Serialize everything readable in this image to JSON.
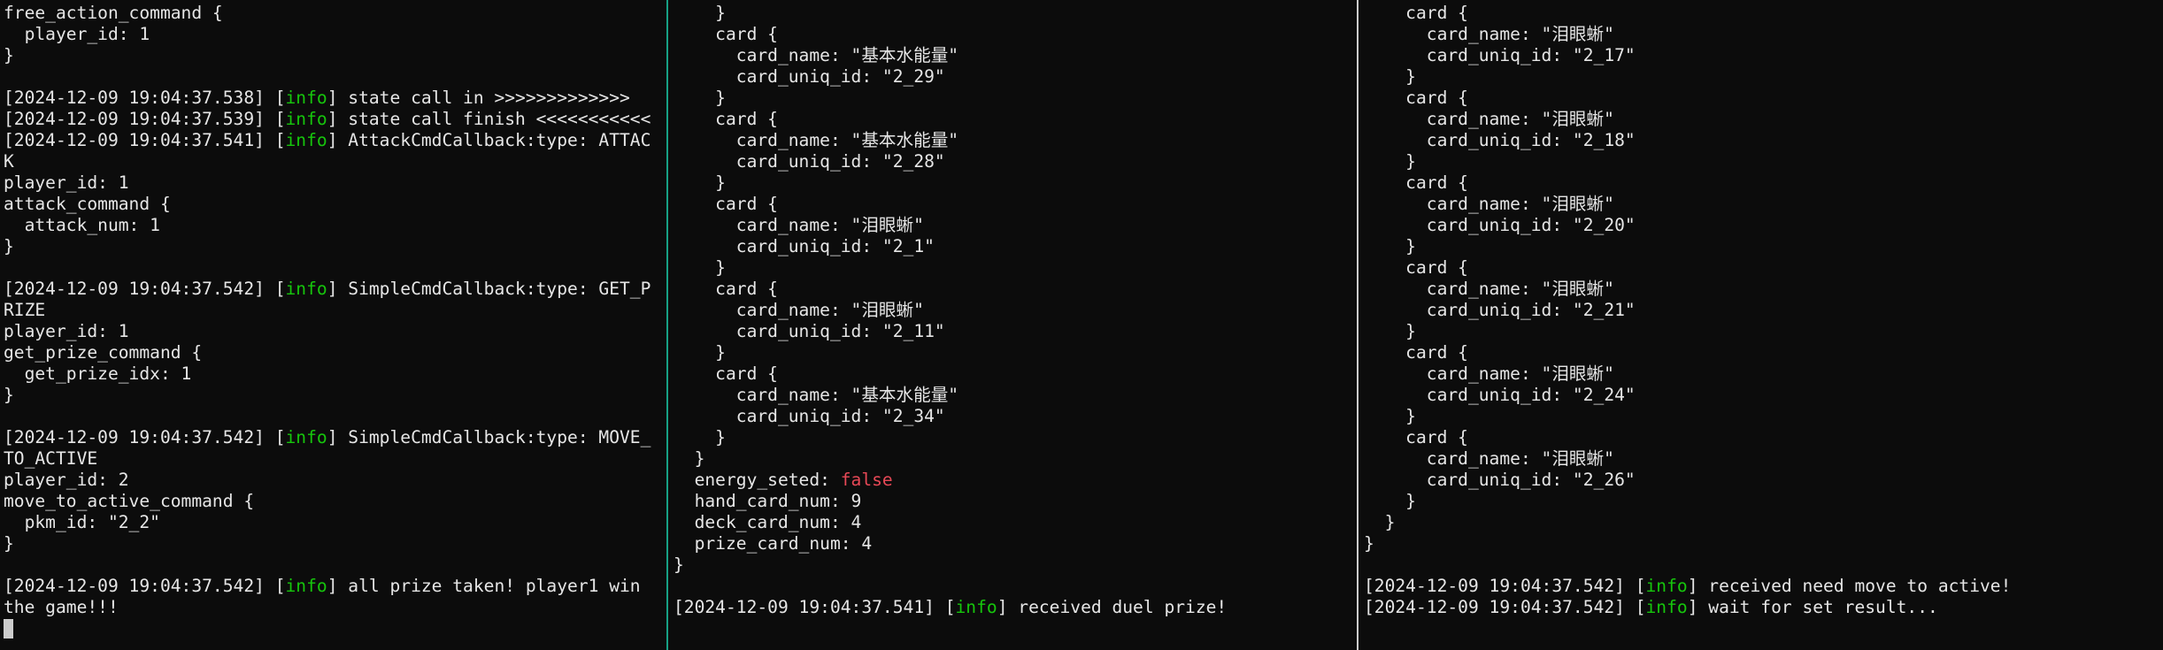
{
  "colors": {
    "background": "#0c0c0c",
    "text": "#e6e6e6",
    "info": "#16c60c",
    "false_literal": "#e74856",
    "divider_1": "#16a085",
    "divider_2": "#cccccc",
    "cursor": "#cccccc"
  },
  "panes": [
    {
      "lines": [
        [
          {
            "t": "free_action_command {"
          }
        ],
        [
          {
            "t": "  player_id: 1"
          }
        ],
        [
          {
            "t": "}"
          }
        ],
        [
          {
            "t": ""
          }
        ],
        [
          {
            "t": "[2024-12-09 19:04:37.538] ["
          },
          {
            "t": "info",
            "c": "info"
          },
          {
            "t": "] state call in >>>>>>>>>>>>>"
          }
        ],
        [
          {
            "t": "[2024-12-09 19:04:37.539] ["
          },
          {
            "t": "info",
            "c": "info"
          },
          {
            "t": "] state call finish <<<<<<<<<<<"
          }
        ],
        [
          {
            "t": "[2024-12-09 19:04:37.541] ["
          },
          {
            "t": "info",
            "c": "info"
          },
          {
            "t": "] AttackCmdCallback:type: ATTAC"
          }
        ],
        [
          {
            "t": "K"
          }
        ],
        [
          {
            "t": "player_id: 1"
          }
        ],
        [
          {
            "t": "attack_command {"
          }
        ],
        [
          {
            "t": "  attack_num: 1"
          }
        ],
        [
          {
            "t": "}"
          }
        ],
        [
          {
            "t": ""
          }
        ],
        [
          {
            "t": "[2024-12-09 19:04:37.542] ["
          },
          {
            "t": "info",
            "c": "info"
          },
          {
            "t": "] SimpleCmdCallback:type: GET_P"
          }
        ],
        [
          {
            "t": "RIZE"
          }
        ],
        [
          {
            "t": "player_id: 1"
          }
        ],
        [
          {
            "t": "get_prize_command {"
          }
        ],
        [
          {
            "t": "  get_prize_idx: 1"
          }
        ],
        [
          {
            "t": "}"
          }
        ],
        [
          {
            "t": ""
          }
        ],
        [
          {
            "t": "[2024-12-09 19:04:37.542] ["
          },
          {
            "t": "info",
            "c": "info"
          },
          {
            "t": "] SimpleCmdCallback:type: MOVE_"
          }
        ],
        [
          {
            "t": "TO_ACTIVE"
          }
        ],
        [
          {
            "t": "player_id: 2"
          }
        ],
        [
          {
            "t": "move_to_active_command {"
          }
        ],
        [
          {
            "t": "  pkm_id: \"2_2\""
          }
        ],
        [
          {
            "t": "}"
          }
        ],
        [
          {
            "t": ""
          }
        ],
        [
          {
            "t": "[2024-12-09 19:04:37.542] ["
          },
          {
            "t": "info",
            "c": "info"
          },
          {
            "t": "] all prize taken! player1 win"
          }
        ],
        [
          {
            "t": "the game!!!"
          }
        ]
      ]
    },
    {
      "lines": [
        [
          {
            "t": "    }"
          }
        ],
        [
          {
            "t": "    card {"
          }
        ],
        [
          {
            "t": "      card_name: \"基本水能量\""
          }
        ],
        [
          {
            "t": "      card_uniq_id: \"2_29\""
          }
        ],
        [
          {
            "t": "    }"
          }
        ],
        [
          {
            "t": "    card {"
          }
        ],
        [
          {
            "t": "      card_name: \"基本水能量\""
          }
        ],
        [
          {
            "t": "      card_uniq_id: \"2_28\""
          }
        ],
        [
          {
            "t": "    }"
          }
        ],
        [
          {
            "t": "    card {"
          }
        ],
        [
          {
            "t": "      card_name: \"泪眼蜥\""
          }
        ],
        [
          {
            "t": "      card_uniq_id: \"2_1\""
          }
        ],
        [
          {
            "t": "    }"
          }
        ],
        [
          {
            "t": "    card {"
          }
        ],
        [
          {
            "t": "      card_name: \"泪眼蜥\""
          }
        ],
        [
          {
            "t": "      card_uniq_id: \"2_11\""
          }
        ],
        [
          {
            "t": "    }"
          }
        ],
        [
          {
            "t": "    card {"
          }
        ],
        [
          {
            "t": "      card_name: \"基本水能量\""
          }
        ],
        [
          {
            "t": "      card_uniq_id: \"2_34\""
          }
        ],
        [
          {
            "t": "    }"
          }
        ],
        [
          {
            "t": "  }"
          }
        ],
        [
          {
            "t": "  energy_seted: "
          },
          {
            "t": "false",
            "c": "bool"
          }
        ],
        [
          {
            "t": "  hand_card_num: 9"
          }
        ],
        [
          {
            "t": "  deck_card_num: 4"
          }
        ],
        [
          {
            "t": "  prize_card_num: 4"
          }
        ],
        [
          {
            "t": "}"
          }
        ],
        [
          {
            "t": ""
          }
        ],
        [
          {
            "t": "[2024-12-09 19:04:37.541] ["
          },
          {
            "t": "info",
            "c": "info"
          },
          {
            "t": "] received duel prize!"
          }
        ]
      ]
    },
    {
      "lines": [
        [
          {
            "t": "    card {"
          }
        ],
        [
          {
            "t": "      card_name: \"泪眼蜥\""
          }
        ],
        [
          {
            "t": "      card_uniq_id: \"2_17\""
          }
        ],
        [
          {
            "t": "    }"
          }
        ],
        [
          {
            "t": "    card {"
          }
        ],
        [
          {
            "t": "      card_name: \"泪眼蜥\""
          }
        ],
        [
          {
            "t": "      card_uniq_id: \"2_18\""
          }
        ],
        [
          {
            "t": "    }"
          }
        ],
        [
          {
            "t": "    card {"
          }
        ],
        [
          {
            "t": "      card_name: \"泪眼蜥\""
          }
        ],
        [
          {
            "t": "      card_uniq_id: \"2_20\""
          }
        ],
        [
          {
            "t": "    }"
          }
        ],
        [
          {
            "t": "    card {"
          }
        ],
        [
          {
            "t": "      card_name: \"泪眼蜥\""
          }
        ],
        [
          {
            "t": "      card_uniq_id: \"2_21\""
          }
        ],
        [
          {
            "t": "    }"
          }
        ],
        [
          {
            "t": "    card {"
          }
        ],
        [
          {
            "t": "      card_name: \"泪眼蜥\""
          }
        ],
        [
          {
            "t": "      card_uniq_id: \"2_24\""
          }
        ],
        [
          {
            "t": "    }"
          }
        ],
        [
          {
            "t": "    card {"
          }
        ],
        [
          {
            "t": "      card_name: \"泪眼蜥\""
          }
        ],
        [
          {
            "t": "      card_uniq_id: \"2_26\""
          }
        ],
        [
          {
            "t": "    }"
          }
        ],
        [
          {
            "t": "  }"
          }
        ],
        [
          {
            "t": "}"
          }
        ],
        [
          {
            "t": ""
          }
        ],
        [
          {
            "t": "[2024-12-09 19:04:37.542] ["
          },
          {
            "t": "info",
            "c": "info"
          },
          {
            "t": "] received need move to active!"
          }
        ],
        [
          {
            "t": "[2024-12-09 19:04:37.542] ["
          },
          {
            "t": "info",
            "c": "info"
          },
          {
            "t": "] wait for set result..."
          }
        ]
      ]
    }
  ]
}
